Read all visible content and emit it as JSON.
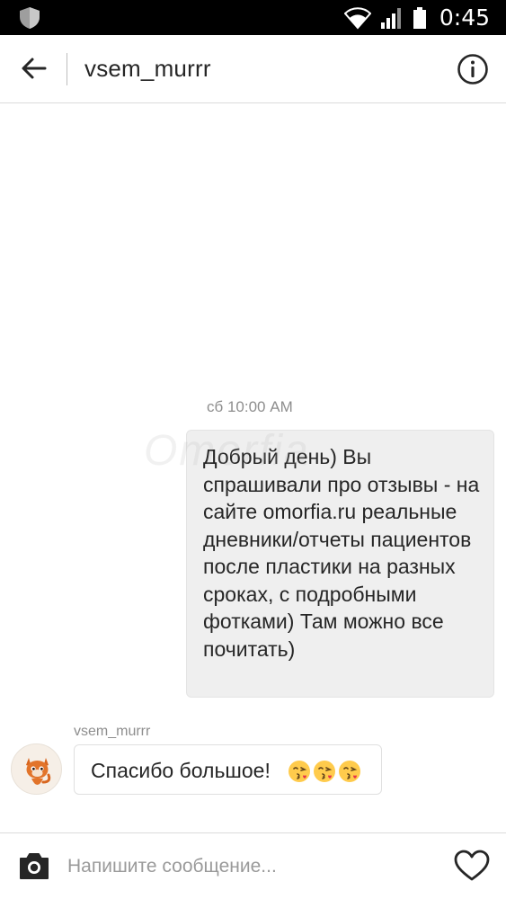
{
  "status_bar": {
    "time": "0:45"
  },
  "header": {
    "title": "vsem_murrr"
  },
  "conversation": {
    "timestamp": "сб 10:00 AM",
    "outgoing_message": "Добрый день) Вы спрашивали про отзывы - на сайте omorfia.ru реальные дневники/отчеты пациентов после пластики на разных сроках, с подробными фотками) Там можно все почитать)",
    "incoming_sender": "vsem_murrr",
    "incoming_message": "Спасибо большое!",
    "incoming_emojis": [
      "kissing-face-icon",
      "kissing-face-icon",
      "kissing-face-icon"
    ]
  },
  "watermark": {
    "text": "Omorfia"
  },
  "composer": {
    "placeholder": "Напишите сообщение..."
  }
}
